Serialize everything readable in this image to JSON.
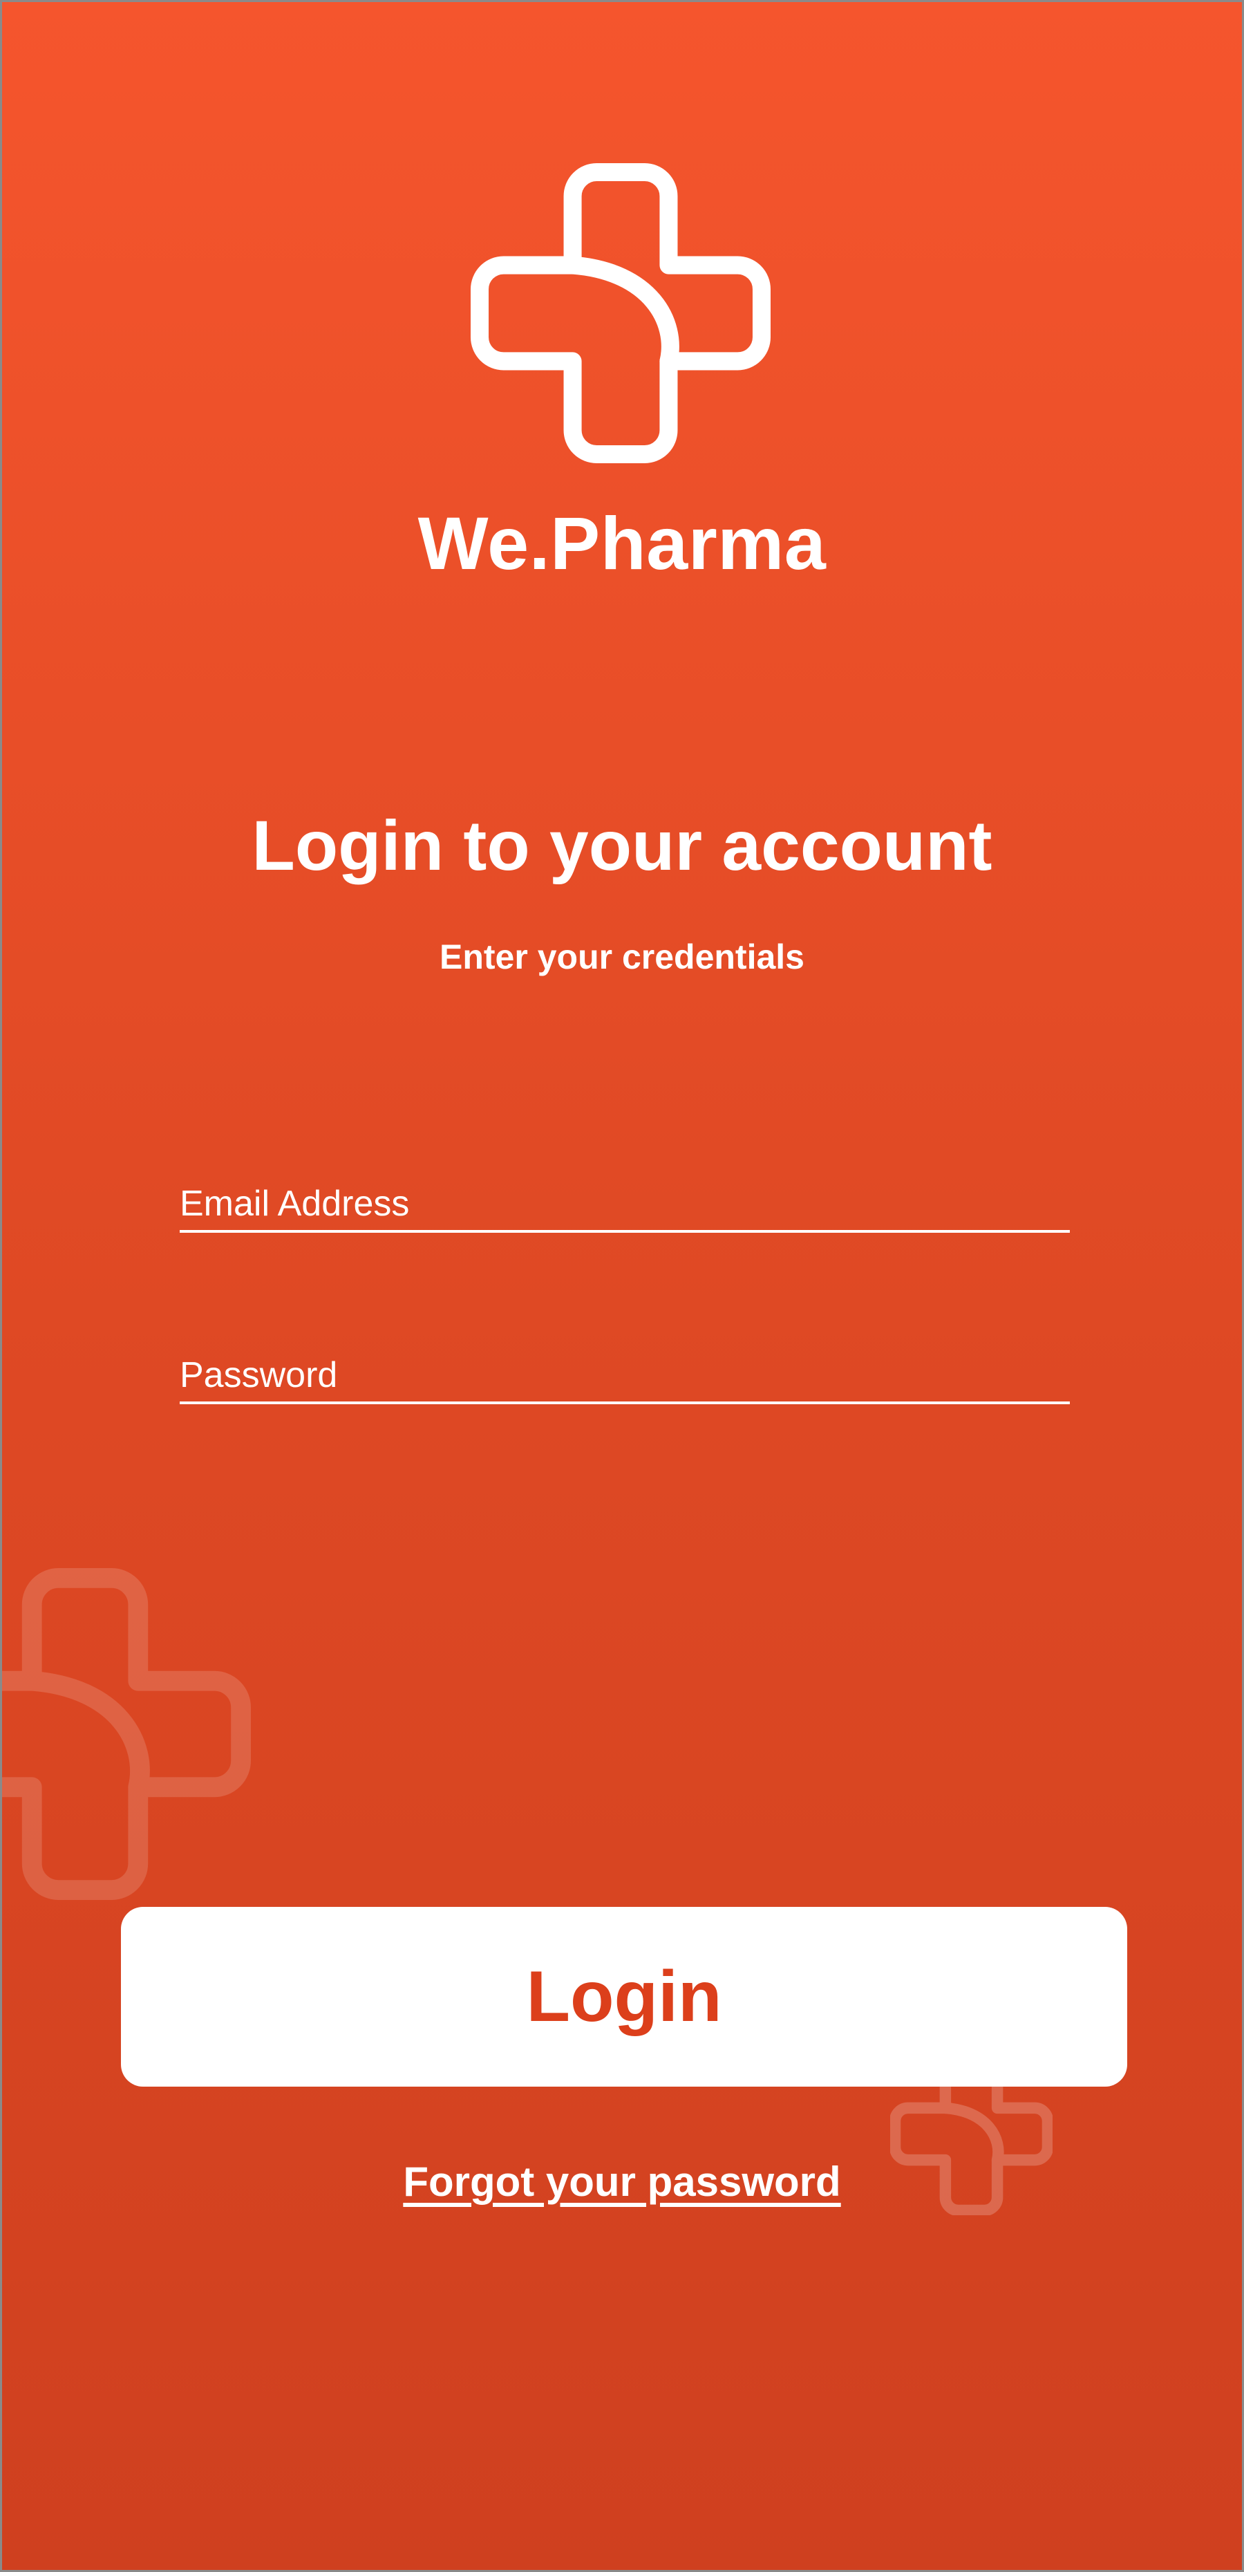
{
  "brand": {
    "name": "We.Pharma",
    "logo_icon": "medical-cross-leaf-icon"
  },
  "login": {
    "title": "Login to your account",
    "subtitle": "Enter your credentials",
    "email_placeholder": "Email Address",
    "email_value": "",
    "password_placeholder": "Password",
    "password_value": "",
    "button_label": "Login",
    "forgot_label": "Forgot your password "
  },
  "colors": {
    "background_top": "#f5552d",
    "background_bottom": "#cf401f",
    "accent": "#dc3f1b",
    "text": "#ffffff"
  }
}
